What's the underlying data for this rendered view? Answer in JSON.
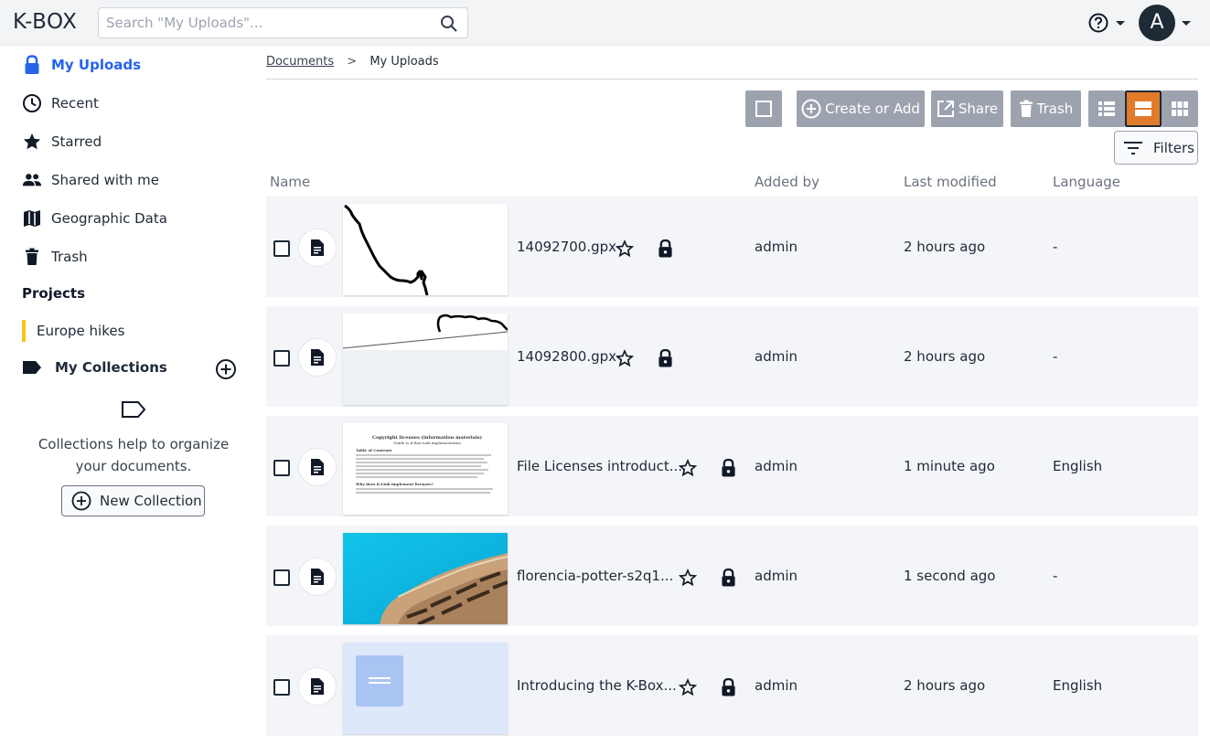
{
  "app": {
    "logo": "K-BOX"
  },
  "search": {
    "placeholder": "Search \"My Uploads\"..."
  },
  "user": {
    "avatar_letter": "A"
  },
  "sidebar": {
    "items": [
      {
        "label": "My Uploads",
        "icon": "lock-icon",
        "active": true
      },
      {
        "label": "Recent",
        "icon": "clock-icon"
      },
      {
        "label": "Starred",
        "icon": "star-icon"
      },
      {
        "label": "Shared with me",
        "icon": "people-icon"
      },
      {
        "label": "Geographic Data",
        "icon": "map-icon"
      },
      {
        "label": "Trash",
        "icon": "trash-icon"
      }
    ],
    "projects_title": "Projects",
    "projects": [
      {
        "label": "Europe hikes",
        "color": "#f5c518"
      }
    ],
    "collections_title": "My Collections",
    "collections_help": "Collections help to organize your documents.",
    "new_collection_label": "New Collection"
  },
  "breadcrumb": {
    "root": "Documents",
    "separator": ">",
    "current": "My Uploads"
  },
  "toolbar": {
    "create_label": "Create or Add",
    "share_label": "Share",
    "trash_label": "Trash",
    "filters_label": "Filters",
    "active_view": "cards",
    "accent": "#e07b2b",
    "button_color": "#9ca3af"
  },
  "columns": {
    "name": "Name",
    "added_by": "Added by",
    "last_modified": "Last modified",
    "language": "Language"
  },
  "rows": [
    {
      "name": "14092700.gpx",
      "added_by": "admin",
      "modified": "2 hours ago",
      "language": "-"
    },
    {
      "name": "14092800.gpx",
      "added_by": "admin",
      "modified": "2 hours ago",
      "language": "-"
    },
    {
      "name": "File Licenses introduct...",
      "added_by": "admin",
      "modified": "1 minute ago",
      "language": "English",
      "thumb_title": "Copyright licenses (information materials)",
      "thumb_sub": "Guide to K-Box-Link implementation",
      "thumb_toc": "Table of Contents",
      "thumb_section": "Why does K-Link implement licenses?"
    },
    {
      "name": "florencia-potter-s2q1...",
      "added_by": "admin",
      "modified": "1 second ago",
      "language": "-"
    },
    {
      "name": "Introducing the K-Box...",
      "added_by": "admin",
      "modified": "2 hours ago",
      "language": "English"
    }
  ]
}
